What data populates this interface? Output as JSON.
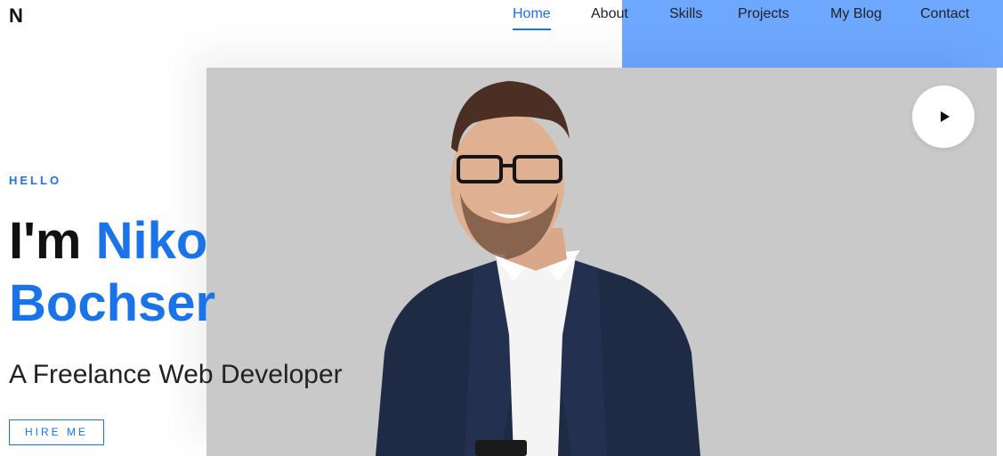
{
  "brand": {
    "logo": "N",
    "accent_color": "#1a73e8",
    "accent_block_color": "#6ea8fe"
  },
  "nav": {
    "items": [
      {
        "label": "Home",
        "active": true
      },
      {
        "label": "About",
        "active": false
      },
      {
        "label": "Skills",
        "active": false
      },
      {
        "label": "Projects",
        "active": false
      },
      {
        "label": "My Blog",
        "active": false
      },
      {
        "label": "Contact",
        "active": false
      }
    ]
  },
  "hero": {
    "eyebrow": "HELLO",
    "greeting": "I'm",
    "first_name": "Niko",
    "last_name": "Bochser",
    "subtitle": "A Freelance Web Developer",
    "cta_label": "HIRE ME",
    "play_icon": "play-icon",
    "photo_description_icon": "portrait-photo"
  }
}
